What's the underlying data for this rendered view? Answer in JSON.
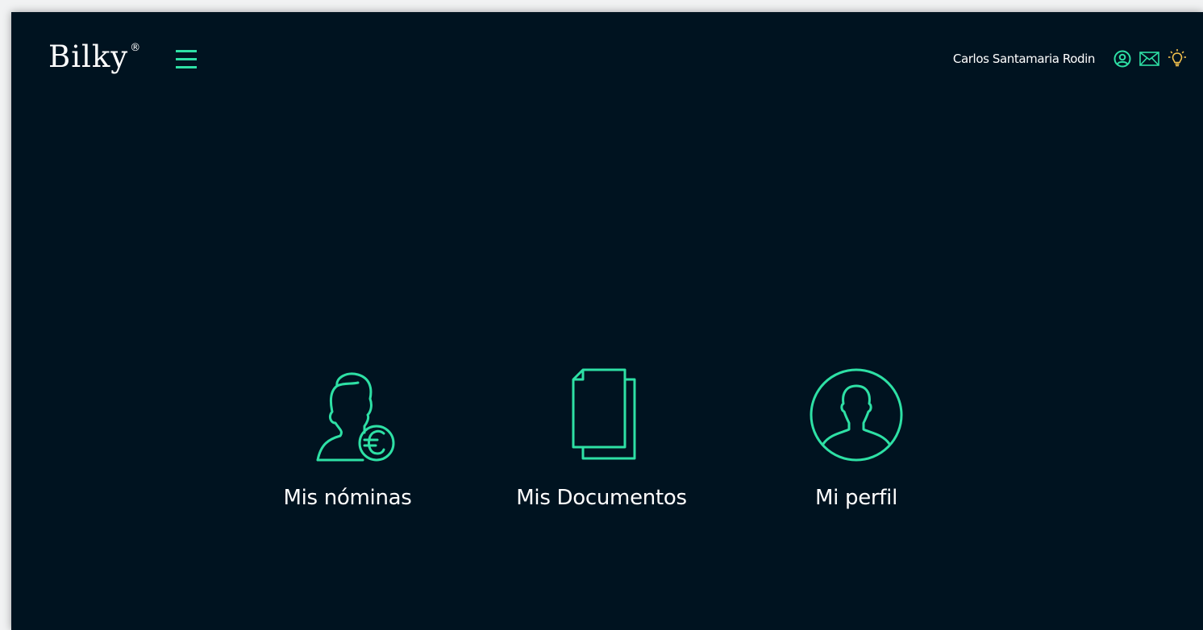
{
  "header": {
    "logo_text": "Bilky",
    "logo_mark": "®",
    "menu_icon": "hamburger-menu-icon",
    "user_name": "Carlos Santamaria Rodin",
    "icons": [
      "user-circle-icon",
      "mail-envelope-icon",
      "lightbulb-icon"
    ]
  },
  "tiles": [
    {
      "label": "Mis nóminas",
      "icon": "user-payroll-euro-icon"
    },
    {
      "label": "Mis Documentos",
      "icon": "documents-icon"
    },
    {
      "label": "Mi perfil",
      "icon": "profile-avatar-icon"
    }
  ],
  "colors": {
    "background": "#001320",
    "accent": "#2ee0a5",
    "text": "#ffffff",
    "highlight": "#f2c14e",
    "page_border": "#f1f2f3"
  }
}
